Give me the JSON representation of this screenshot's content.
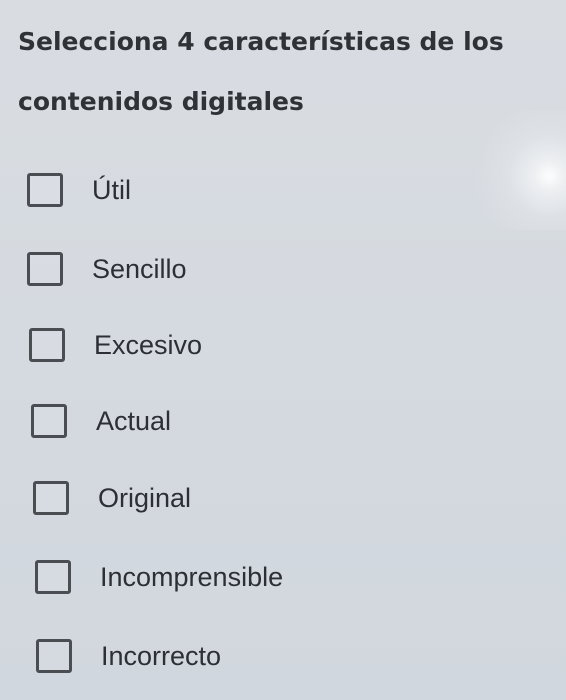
{
  "question": {
    "text": "Selecciona 4 características de los contenidos digitales"
  },
  "options": [
    {
      "label": "Útil",
      "checked": false
    },
    {
      "label": "Sencillo",
      "checked": false
    },
    {
      "label": "Excesivo",
      "checked": false
    },
    {
      "label": "Actual",
      "checked": false
    },
    {
      "label": "Original",
      "checked": false
    },
    {
      "label": "Incomprensible",
      "checked": false
    },
    {
      "label": "Incorrecto",
      "checked": false
    }
  ]
}
